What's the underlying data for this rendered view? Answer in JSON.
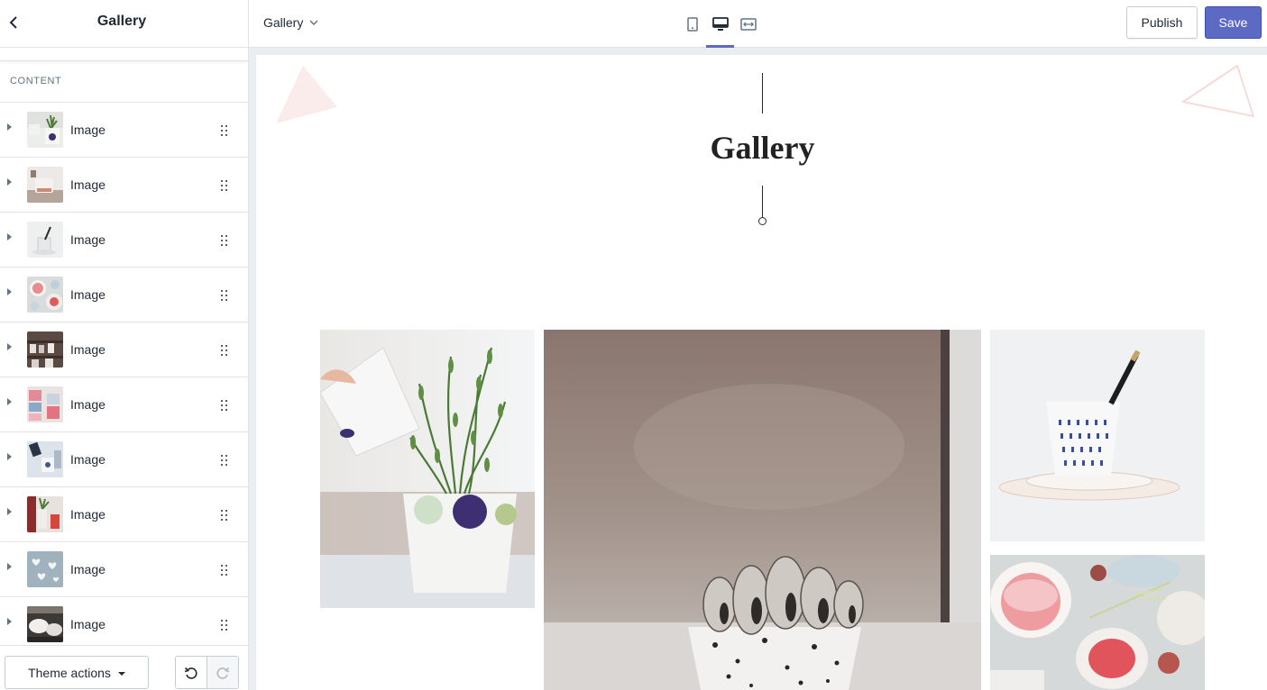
{
  "header": {
    "sidebar_title": "Gallery",
    "page_selector": "Gallery",
    "publish_label": "Publish",
    "save_label": "Save",
    "active_device": "desktop",
    "accent_color": "#5c6ac4"
  },
  "sidebar": {
    "section_heading": "CONTENT",
    "blocks": [
      {
        "label": "Image",
        "thumb": "plant-watering"
      },
      {
        "label": "Image",
        "thumb": "mug-on-table"
      },
      {
        "label": "Image",
        "thumb": "glass-with-straw"
      },
      {
        "label": "Image",
        "thumb": "pink-plates"
      },
      {
        "label": "Image",
        "thumb": "shelf-ceramics"
      },
      {
        "label": "Image",
        "thumb": "stacked-cups"
      },
      {
        "label": "Image",
        "thumb": "pouring-cup"
      },
      {
        "label": "Image",
        "thumb": "vase-flowers"
      },
      {
        "label": "Image",
        "thumb": "hearts-pattern"
      },
      {
        "label": "Image",
        "thumb": "bowls"
      }
    ],
    "footer": {
      "theme_actions_label": "Theme actions"
    }
  },
  "preview": {
    "heading": "Gallery",
    "images": [
      {
        "subject": "watering a rosemary plant in a polka-dot pot"
      },
      {
        "subject": "cactus in a speckled pot"
      },
      {
        "subject": "patterned cup with black straw on saucer"
      },
      {
        "subject": "pink ceramic plates with figs"
      }
    ]
  }
}
